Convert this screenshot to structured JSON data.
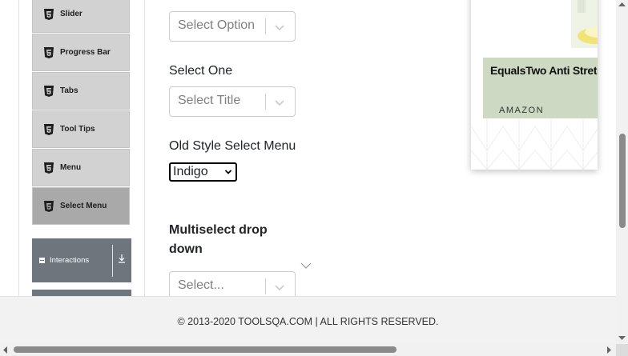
{
  "sidebar": {
    "items": [
      {
        "label": "Slider",
        "icon": "html5-icon"
      },
      {
        "label": "Progress Bar",
        "icon": "html5-icon"
      },
      {
        "label": "Tabs",
        "icon": "html5-icon"
      },
      {
        "label": "Tool Tips",
        "icon": "html5-icon"
      },
      {
        "label": "Menu",
        "icon": "html5-icon"
      },
      {
        "label": "Select Menu",
        "icon": "html5-icon",
        "active": true
      }
    ],
    "group": {
      "label": "Interactions",
      "icon": "minus-square-icon",
      "toggle_icon": "download-arrow-icon"
    }
  },
  "main": {
    "select_value": {
      "placeholder": "Select Option"
    },
    "select_one": {
      "label": "Select One",
      "placeholder": "Select Title"
    },
    "old_style": {
      "label": "Old Style Select Menu",
      "value": "Indigo"
    },
    "multiselect": {
      "label": "Multiselect drop down",
      "placeholder": "Select..."
    }
  },
  "ad": {
    "title": "EqualsTwo Anti Stretch",
    "brand": "AMAZON"
  },
  "footer": {
    "text": "© 2013-2020 TOOLSQA.COM | ALL RIGHTS RESERVED."
  },
  "colors": {
    "sidebar_item_bg": "#d2d2d2",
    "sidebar_active_bg": "#a9a9a9",
    "group_header_bg": "#6e757c",
    "ad_green": "#cdd9c3",
    "footer_bg": "#f2f2f2"
  }
}
